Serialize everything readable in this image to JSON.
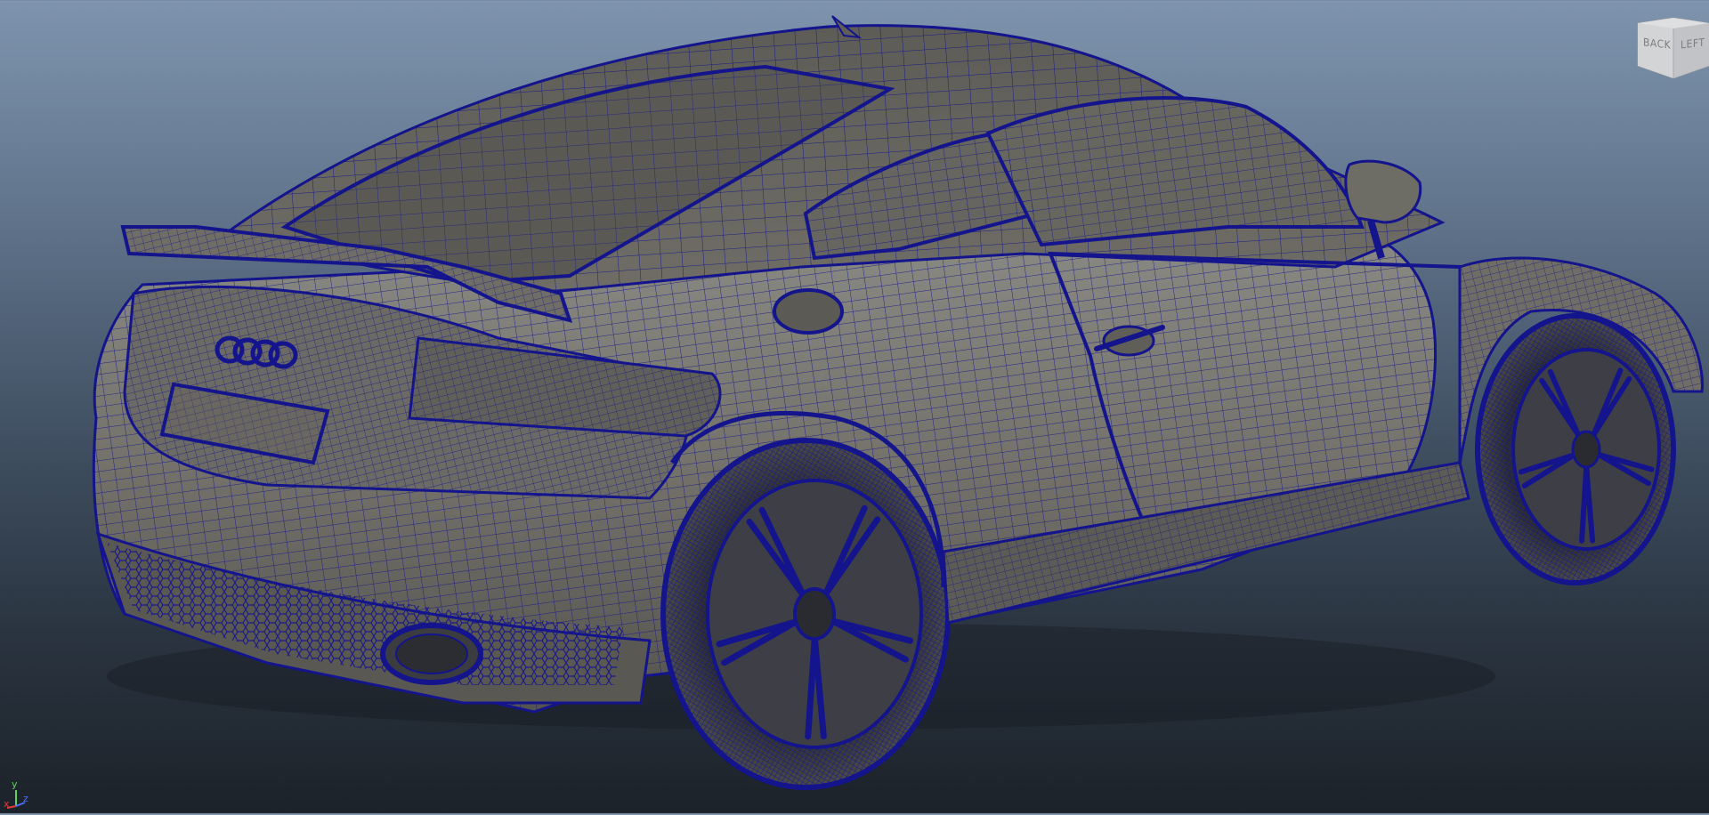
{
  "viewport": {
    "background_top": "#7e93ad",
    "background_bottom": "#1c2229",
    "wireframe_color": "#14148c",
    "shaded_color": "#77746c",
    "model": {
      "logo_rings": 4
    }
  },
  "view_cube": {
    "faces": {
      "back": "BACK",
      "left": "LEFT"
    }
  },
  "axis_gizmo": {
    "y": "y",
    "x": "x",
    "z": "z",
    "colors": {
      "x": "#e23b3b",
      "y": "#5ed35e",
      "z": "#4d6bff"
    }
  }
}
